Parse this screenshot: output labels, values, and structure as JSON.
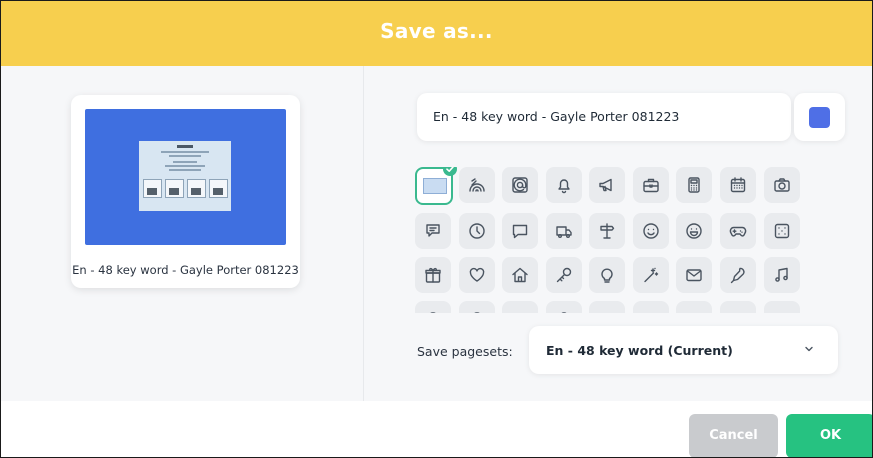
{
  "dialog": {
    "title": "Save as..."
  },
  "preview": {
    "name": "En - 48 key word - Gayle Porter 081223"
  },
  "name_field": {
    "value": "En - 48 key word - Gayle Porter 081223"
  },
  "color": {
    "swatch": "#4f6fe6"
  },
  "icons": [
    "current-thumbnail",
    "rainbow",
    "at-sign",
    "bell",
    "megaphone",
    "toolbox",
    "calculator",
    "calendar",
    "camera",
    "chat",
    "clock",
    "speech-bubble",
    "truck",
    "signpost",
    "smile",
    "grin",
    "gamepad",
    "dice",
    "gift",
    "heart",
    "home",
    "key",
    "lightbulb",
    "magic-wand",
    "envelope",
    "microphone",
    "music-note",
    "row4-1",
    "row4-2",
    "row4-3",
    "row4-4",
    "row4-5",
    "row4-6",
    "row4-7",
    "row4-8",
    "row4-9"
  ],
  "pagesets": {
    "label": "Save pagesets:",
    "value": "En - 48 key word (Current)"
  },
  "buttons": {
    "cancel": "Cancel",
    "ok": "OK"
  }
}
